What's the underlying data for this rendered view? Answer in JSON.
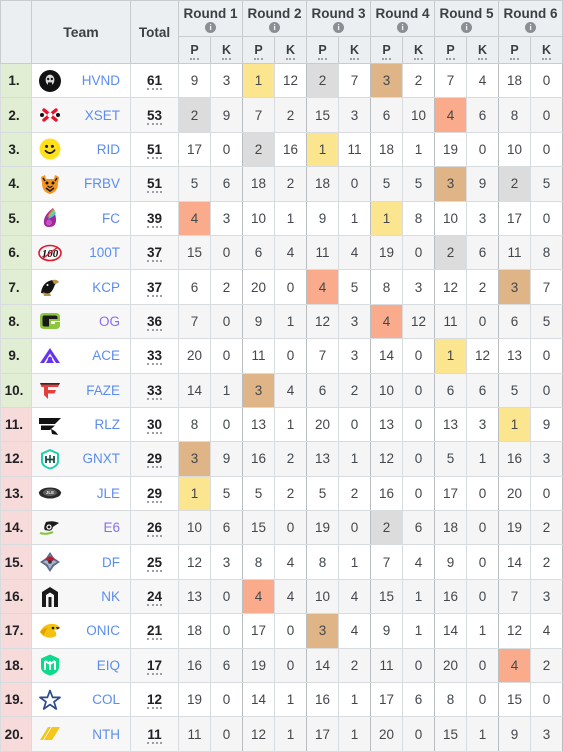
{
  "header": {
    "rank_label": "",
    "team_label": "Team",
    "total_label": "Total",
    "rounds": [
      "Round 1",
      "Round 2",
      "Round 3",
      "Round 4",
      "Round 5",
      "Round 6"
    ],
    "sub_points": "P",
    "sub_kills": "K",
    "info_icon": "info-icon"
  },
  "colors": {
    "rank_qualified": "#e2eed3",
    "rank_unqualified": "#f7dada",
    "highlight_1st": "#fbe58f",
    "highlight_2nd": "#dcdcdc",
    "highlight_3rd": "#dfb486",
    "highlight_4th": "#f9ab8b",
    "team_link": "#5b8def",
    "team_link_alt": "#8a6fe8",
    "header_bg": "#eceff1"
  },
  "rows": [
    {
      "rank": "1.",
      "team": "HVND",
      "logo": "hvnd-logo",
      "total": "61",
      "qualified": true,
      "cells": [
        {
          "v": "9"
        },
        {
          "v": "3"
        },
        {
          "v": "1",
          "hl": "hl1"
        },
        {
          "v": "12"
        },
        {
          "v": "2",
          "hl": "hl2"
        },
        {
          "v": "7"
        },
        {
          "v": "3",
          "hl": "hl3"
        },
        {
          "v": "2"
        },
        {
          "v": "7"
        },
        {
          "v": "4"
        },
        {
          "v": "18"
        },
        {
          "v": "0"
        }
      ]
    },
    {
      "rank": "2.",
      "team": "XSET",
      "logo": "xset-logo",
      "total": "53",
      "qualified": true,
      "cells": [
        {
          "v": "2",
          "hl": "hl2"
        },
        {
          "v": "9"
        },
        {
          "v": "7"
        },
        {
          "v": "2"
        },
        {
          "v": "15"
        },
        {
          "v": "3"
        },
        {
          "v": "6"
        },
        {
          "v": "10"
        },
        {
          "v": "4",
          "hl": "hl4"
        },
        {
          "v": "6"
        },
        {
          "v": "8"
        },
        {
          "v": "0"
        }
      ]
    },
    {
      "rank": "3.",
      "team": "RID",
      "logo": "rid-logo",
      "total": "51",
      "qualified": true,
      "cells": [
        {
          "v": "17"
        },
        {
          "v": "0"
        },
        {
          "v": "2",
          "hl": "hl2"
        },
        {
          "v": "16"
        },
        {
          "v": "1",
          "hl": "hl1"
        },
        {
          "v": "11"
        },
        {
          "v": "18"
        },
        {
          "v": "1"
        },
        {
          "v": "19"
        },
        {
          "v": "0"
        },
        {
          "v": "10"
        },
        {
          "v": "0"
        }
      ]
    },
    {
      "rank": "4.",
      "team": "FRBV",
      "logo": "frbv-logo",
      "total": "51",
      "qualified": true,
      "cells": [
        {
          "v": "5"
        },
        {
          "v": "6"
        },
        {
          "v": "18"
        },
        {
          "v": "2"
        },
        {
          "v": "18"
        },
        {
          "v": "0"
        },
        {
          "v": "5"
        },
        {
          "v": "5"
        },
        {
          "v": "3",
          "hl": "hl3"
        },
        {
          "v": "9"
        },
        {
          "v": "2",
          "hl": "hl2"
        },
        {
          "v": "5"
        }
      ]
    },
    {
      "rank": "5.",
      "team": "FC",
      "logo": "fc-logo",
      "total": "39",
      "qualified": true,
      "cells": [
        {
          "v": "4",
          "hl": "hl4"
        },
        {
          "v": "3"
        },
        {
          "v": "10"
        },
        {
          "v": "1"
        },
        {
          "v": "9"
        },
        {
          "v": "1"
        },
        {
          "v": "1",
          "hl": "hl1"
        },
        {
          "v": "8"
        },
        {
          "v": "10"
        },
        {
          "v": "3"
        },
        {
          "v": "17"
        },
        {
          "v": "0"
        }
      ]
    },
    {
      "rank": "6.",
      "team": "100T",
      "logo": "100t-logo",
      "total": "37",
      "qualified": true,
      "cells": [
        {
          "v": "15"
        },
        {
          "v": "0"
        },
        {
          "v": "6"
        },
        {
          "v": "4"
        },
        {
          "v": "11"
        },
        {
          "v": "4"
        },
        {
          "v": "19"
        },
        {
          "v": "0"
        },
        {
          "v": "2",
          "hl": "hl2"
        },
        {
          "v": "6"
        },
        {
          "v": "11"
        },
        {
          "v": "8"
        }
      ]
    },
    {
      "rank": "7.",
      "team": "KCP",
      "logo": "kcp-logo",
      "total": "37",
      "qualified": true,
      "cells": [
        {
          "v": "6"
        },
        {
          "v": "2"
        },
        {
          "v": "20"
        },
        {
          "v": "0"
        },
        {
          "v": "4",
          "hl": "hl4"
        },
        {
          "v": "5"
        },
        {
          "v": "8"
        },
        {
          "v": "3"
        },
        {
          "v": "12"
        },
        {
          "v": "2"
        },
        {
          "v": "3",
          "hl": "hl3"
        },
        {
          "v": "7"
        }
      ]
    },
    {
      "rank": "8.",
      "team": "OG",
      "logo": "og-logo",
      "total": "36",
      "qualified": true,
      "purple": true,
      "cells": [
        {
          "v": "7"
        },
        {
          "v": "0"
        },
        {
          "v": "9"
        },
        {
          "v": "1"
        },
        {
          "v": "12"
        },
        {
          "v": "3"
        },
        {
          "v": "4",
          "hl": "hl4"
        },
        {
          "v": "12"
        },
        {
          "v": "11"
        },
        {
          "v": "0"
        },
        {
          "v": "6"
        },
        {
          "v": "5"
        }
      ]
    },
    {
      "rank": "9.",
      "team": "ACE",
      "logo": "ace-logo",
      "total": "33",
      "qualified": true,
      "cells": [
        {
          "v": "20"
        },
        {
          "v": "0"
        },
        {
          "v": "11"
        },
        {
          "v": "0"
        },
        {
          "v": "7"
        },
        {
          "v": "3"
        },
        {
          "v": "14"
        },
        {
          "v": "0"
        },
        {
          "v": "1",
          "hl": "hl1"
        },
        {
          "v": "12"
        },
        {
          "v": "13"
        },
        {
          "v": "0"
        }
      ]
    },
    {
      "rank": "10.",
      "team": "FAZE",
      "logo": "faze-logo",
      "total": "33",
      "qualified": true,
      "cells": [
        {
          "v": "14"
        },
        {
          "v": "1"
        },
        {
          "v": "3",
          "hl": "hl3"
        },
        {
          "v": "4"
        },
        {
          "v": "6"
        },
        {
          "v": "2"
        },
        {
          "v": "10"
        },
        {
          "v": "0"
        },
        {
          "v": "6"
        },
        {
          "v": "6"
        },
        {
          "v": "5"
        },
        {
          "v": "0"
        }
      ]
    },
    {
      "rank": "11.",
      "team": "RLZ",
      "logo": "rlz-logo",
      "total": "30",
      "qualified": false,
      "cells": [
        {
          "v": "8"
        },
        {
          "v": "0"
        },
        {
          "v": "13"
        },
        {
          "v": "1"
        },
        {
          "v": "20"
        },
        {
          "v": "0"
        },
        {
          "v": "13"
        },
        {
          "v": "0"
        },
        {
          "v": "13"
        },
        {
          "v": "3"
        },
        {
          "v": "1",
          "hl": "hl1"
        },
        {
          "v": "9"
        }
      ]
    },
    {
      "rank": "12.",
      "team": "GNXT",
      "logo": "gnxt-logo",
      "total": "29",
      "qualified": false,
      "cells": [
        {
          "v": "3",
          "hl": "hl3"
        },
        {
          "v": "9"
        },
        {
          "v": "16"
        },
        {
          "v": "2"
        },
        {
          "v": "13"
        },
        {
          "v": "1"
        },
        {
          "v": "12"
        },
        {
          "v": "0"
        },
        {
          "v": "5"
        },
        {
          "v": "1"
        },
        {
          "v": "16"
        },
        {
          "v": "3"
        }
      ]
    },
    {
      "rank": "13.",
      "team": "JLE",
      "logo": "jle-logo",
      "total": "29",
      "qualified": false,
      "cells": [
        {
          "v": "1",
          "hl": "hl1"
        },
        {
          "v": "5"
        },
        {
          "v": "5"
        },
        {
          "v": "2"
        },
        {
          "v": "5"
        },
        {
          "v": "2"
        },
        {
          "v": "16"
        },
        {
          "v": "0"
        },
        {
          "v": "17"
        },
        {
          "v": "0"
        },
        {
          "v": "20"
        },
        {
          "v": "0"
        }
      ]
    },
    {
      "rank": "14.",
      "team": "E6",
      "logo": "e6-logo",
      "total": "26",
      "qualified": false,
      "purple": true,
      "cells": [
        {
          "v": "10"
        },
        {
          "v": "6"
        },
        {
          "v": "15"
        },
        {
          "v": "0"
        },
        {
          "v": "19"
        },
        {
          "v": "0"
        },
        {
          "v": "2",
          "hl": "hl2"
        },
        {
          "v": "6"
        },
        {
          "v": "18"
        },
        {
          "v": "0"
        },
        {
          "v": "19"
        },
        {
          "v": "2"
        }
      ]
    },
    {
      "rank": "15.",
      "team": "DF",
      "logo": "df-logo",
      "total": "25",
      "qualified": false,
      "cells": [
        {
          "v": "12"
        },
        {
          "v": "3"
        },
        {
          "v": "8"
        },
        {
          "v": "4"
        },
        {
          "v": "8"
        },
        {
          "v": "1"
        },
        {
          "v": "7"
        },
        {
          "v": "4"
        },
        {
          "v": "9"
        },
        {
          "v": "0"
        },
        {
          "v": "14"
        },
        {
          "v": "2"
        }
      ]
    },
    {
      "rank": "16.",
      "team": "NK",
      "logo": "nk-logo",
      "total": "24",
      "qualified": false,
      "cells": [
        {
          "v": "13"
        },
        {
          "v": "0"
        },
        {
          "v": "4",
          "hl": "hl4"
        },
        {
          "v": "4"
        },
        {
          "v": "10"
        },
        {
          "v": "4"
        },
        {
          "v": "15"
        },
        {
          "v": "1"
        },
        {
          "v": "16"
        },
        {
          "v": "0"
        },
        {
          "v": "7"
        },
        {
          "v": "3"
        }
      ]
    },
    {
      "rank": "17.",
      "team": "ONIC",
      "logo": "onic-logo",
      "total": "21",
      "qualified": false,
      "cells": [
        {
          "v": "18"
        },
        {
          "v": "0"
        },
        {
          "v": "17"
        },
        {
          "v": "0"
        },
        {
          "v": "3",
          "hl": "hl3"
        },
        {
          "v": "4"
        },
        {
          "v": "9"
        },
        {
          "v": "1"
        },
        {
          "v": "14"
        },
        {
          "v": "1"
        },
        {
          "v": "12"
        },
        {
          "v": "4"
        }
      ]
    },
    {
      "rank": "18.",
      "team": "EIQ",
      "logo": "eiq-logo",
      "total": "17",
      "qualified": false,
      "cells": [
        {
          "v": "16"
        },
        {
          "v": "6"
        },
        {
          "v": "19"
        },
        {
          "v": "0"
        },
        {
          "v": "14"
        },
        {
          "v": "2"
        },
        {
          "v": "11"
        },
        {
          "v": "0"
        },
        {
          "v": "20"
        },
        {
          "v": "0"
        },
        {
          "v": "4",
          "hl": "hl4"
        },
        {
          "v": "2"
        }
      ]
    },
    {
      "rank": "19.",
      "team": "COL",
      "logo": "col-logo",
      "total": "12",
      "qualified": false,
      "cells": [
        {
          "v": "19"
        },
        {
          "v": "0"
        },
        {
          "v": "14"
        },
        {
          "v": "1"
        },
        {
          "v": "16"
        },
        {
          "v": "1"
        },
        {
          "v": "17"
        },
        {
          "v": "6"
        },
        {
          "v": "8"
        },
        {
          "v": "0"
        },
        {
          "v": "15"
        },
        {
          "v": "0"
        }
      ]
    },
    {
      "rank": "20.",
      "team": "NTH",
      "logo": "nth-logo",
      "total": "11",
      "qualified": false,
      "cells": [
        {
          "v": "11"
        },
        {
          "v": "0"
        },
        {
          "v": "12"
        },
        {
          "v": "1"
        },
        {
          "v": "17"
        },
        {
          "v": "1"
        },
        {
          "v": "20"
        },
        {
          "v": "0"
        },
        {
          "v": "15"
        },
        {
          "v": "1"
        },
        {
          "v": "9"
        },
        {
          "v": "3"
        }
      ]
    }
  ]
}
